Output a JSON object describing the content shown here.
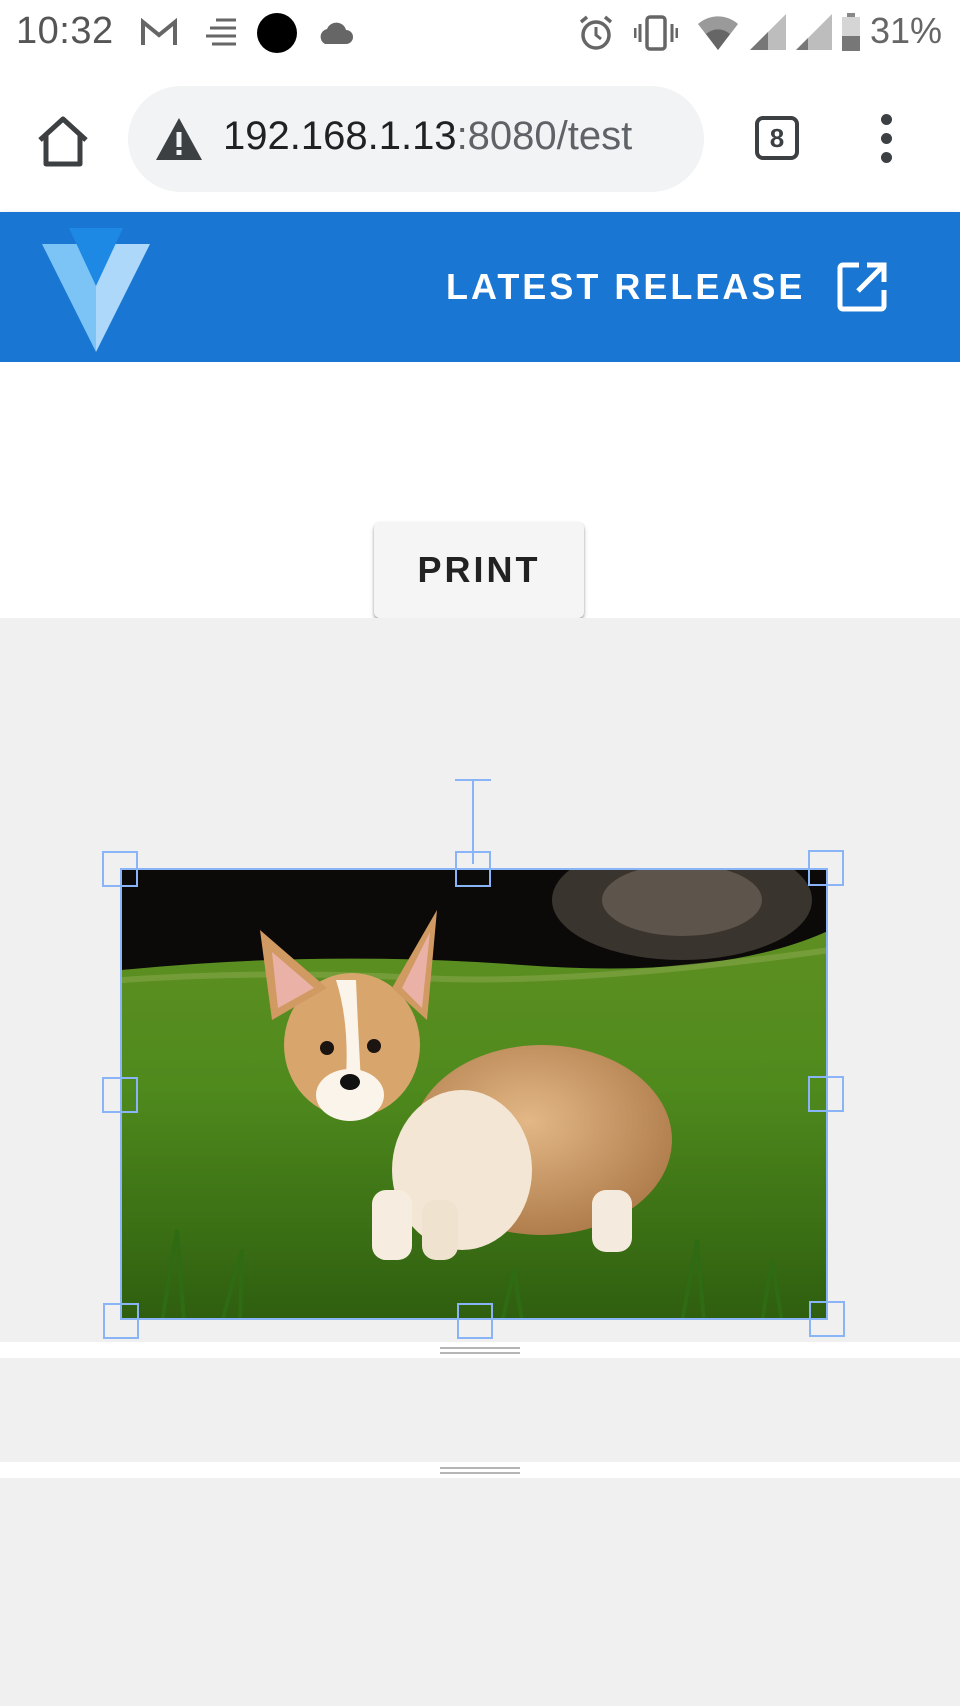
{
  "status_bar": {
    "time": "10:32",
    "battery_percent": "31%",
    "icons": [
      "gmail-icon",
      "news-icon",
      "dot-icon",
      "cloud-icon",
      "alarm-icon",
      "vibrate-icon",
      "wifi-icon",
      "signal-sim1-icon",
      "signal-sim2-icon",
      "battery-icon"
    ]
  },
  "browser": {
    "url_host": "192.168.1.13",
    "url_path": ":8080/test",
    "tab_count": "8"
  },
  "app_bar": {
    "release_label": "LATEST RELEASE",
    "brand_color": "#1976d2"
  },
  "main": {
    "print_label": "PRINT"
  },
  "editor": {
    "selection_color": "#8ab4f8",
    "image_subject": "corgi puppy on grass"
  }
}
